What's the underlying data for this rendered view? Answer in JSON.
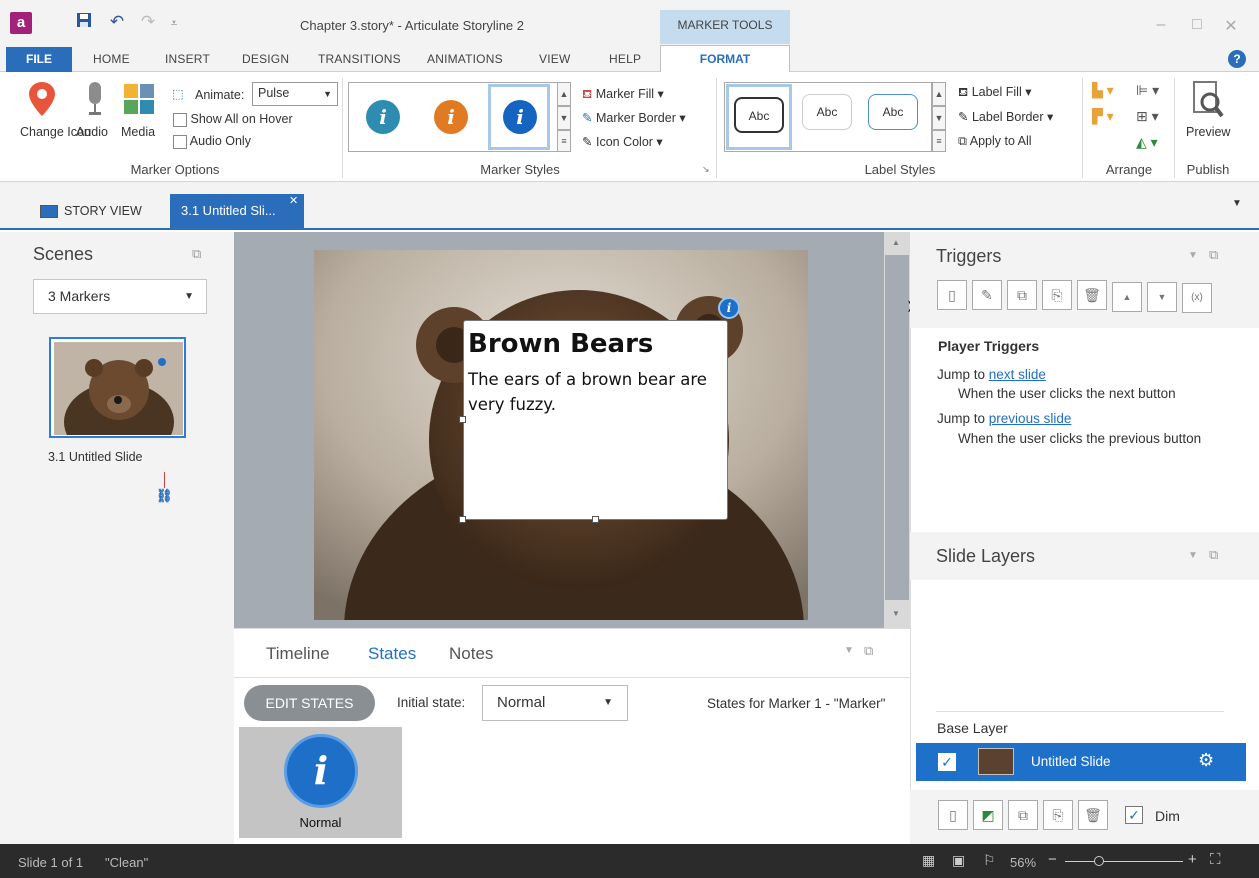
{
  "titlebar": {
    "app_logo": "a",
    "doc_title": "Chapter 3.story* - Articulate Storyline 2",
    "context_tab": "MARKER TOOLS"
  },
  "menu": {
    "file": "FILE",
    "home": "HOME",
    "insert": "INSERT",
    "design": "DESIGN",
    "transitions": "TRANSITIONS",
    "animations": "ANIMATIONS",
    "view": "VIEW",
    "help": "HELP",
    "format": "FORMAT"
  },
  "ribbon": {
    "change_icon": "Change Icon",
    "audio": "Audio",
    "media": "Media",
    "animate_label": "Animate:",
    "animate_value": "Pulse",
    "show_all_hover": "Show All on Hover",
    "audio_only": "Audio Only",
    "marker_options": "Marker Options",
    "marker_fill": "Marker Fill",
    "marker_border": "Marker Border",
    "icon_color": "Icon Color",
    "marker_styles": "Marker Styles",
    "abc": "Abc",
    "label_fill": "Label Fill",
    "label_border": "Label Border",
    "apply_all": "Apply to All",
    "label_styles": "Label Styles",
    "arrange": "Arrange",
    "preview": "Preview",
    "publish": "Publish"
  },
  "colors": {
    "accent": "#2a6ebb",
    "marker_teal": "#2e8cb0",
    "marker_orange": "#e07b23",
    "marker_blue": "#1565c0"
  },
  "doctabs": {
    "story_view": "STORY VIEW",
    "slide_tab": "3.1 Untitled Sli..."
  },
  "scenes": {
    "header": "Scenes",
    "selected": "3 Markers",
    "thumb_label": "3.1 Untitled Slide"
  },
  "slide": {
    "marker_title": "Brown Bears",
    "marker_body": "The ears of a brown bear are very fuzzy."
  },
  "bottom": {
    "timeline": "Timeline",
    "states": "States",
    "notes": "Notes",
    "edit_states": "EDIT STATES",
    "initial_state_label": "Initial state:",
    "initial_state_value": "Normal",
    "states_for": "States for Marker 1 - \"Marker\"",
    "state_normal": "Normal"
  },
  "triggers": {
    "header": "Triggers",
    "player_triggers": "Player Triggers",
    "t1_prefix": "Jump to",
    "t1_link": "next slide",
    "t1_desc": "When the user clicks the next button",
    "t2_prefix": "Jump to",
    "t2_link": "previous slide",
    "t2_desc": "When the user clicks the previous button"
  },
  "layers": {
    "header": "Slide Layers",
    "base_layer": "Base Layer",
    "layer_name": "Untitled Slide",
    "dim": "Dim"
  },
  "status": {
    "slide": "Slide 1 of 1",
    "theme": "\"Clean\"",
    "zoom": "56%"
  }
}
